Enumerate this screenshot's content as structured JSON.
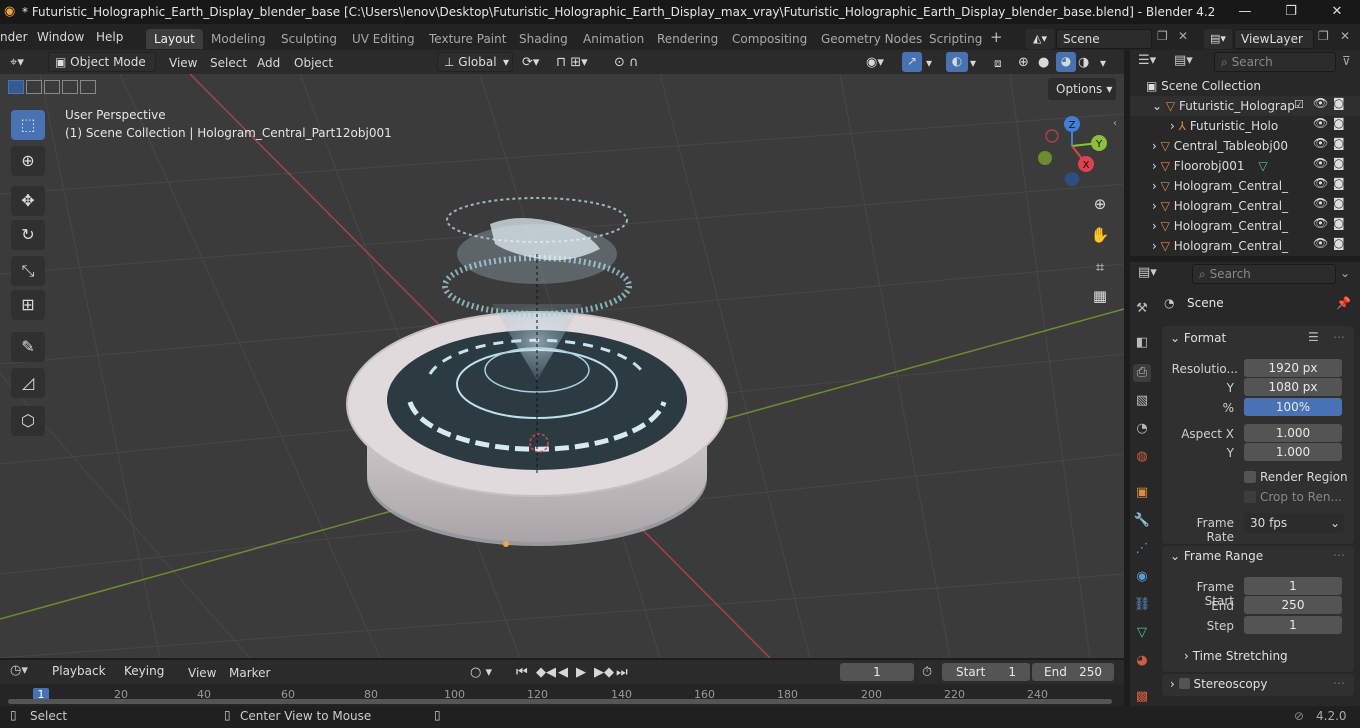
{
  "titlebar": {
    "title": "* Futuristic_Holographic_Earth_Display_blender_base [C:\\Users\\lenov\\Desktop\\Futuristic_Holographic_Earth_Display_max_vray\\Futuristic_Holographic_Earth_Display_blender_base.blend] - Blender 4.2",
    "minimize": "—",
    "maximize": "❐",
    "close": "✕"
  },
  "menu": [
    "nder",
    "Window",
    "Help"
  ],
  "workspaces": [
    "Layout",
    "Modeling",
    "Sculpting",
    "UV Editing",
    "Texture Paint",
    "Shading",
    "Animation",
    "Rendering",
    "Compositing",
    "Geometry Nodes",
    "Scripting"
  ],
  "scene": {
    "name": "Scene",
    "view_layer": "ViewLayer"
  },
  "viewport_header": {
    "mode": "Object Mode",
    "menus": [
      "View",
      "Select",
      "Add",
      "Object"
    ],
    "orientation": "Global",
    "options": "Options"
  },
  "viewport": {
    "perspective": "User Perspective",
    "collection_info": "(1) Scene Collection | Hologram_Central_Part12obj001",
    "gizmo": {
      "z": "Z",
      "y": "Y",
      "x": "X"
    }
  },
  "outliner": {
    "search_placeholder": "Search",
    "root": "Scene Collection",
    "items": [
      {
        "label": "Futuristic_Holograp"
      },
      {
        "label": "Futuristic_Holo"
      },
      {
        "label": "Central_Tableobj00"
      },
      {
        "label": "Floorobj001"
      },
      {
        "label": "Hologram_Central_"
      },
      {
        "label": "Hologram_Central_"
      },
      {
        "label": "Hologram_Central_"
      },
      {
        "label": "Hologram_Central_"
      }
    ]
  },
  "properties": {
    "search_placeholder": "Search",
    "context": "Scene",
    "format_section": "Format",
    "resolution_x_label": "Resolutio...",
    "resolution_x": "1920 px",
    "resolution_y_label": "Y",
    "resolution_y": "1080 px",
    "percent_label": "%",
    "percent": "100%",
    "aspect_x_label": "Aspect X",
    "aspect_x": "1.000",
    "aspect_y_label": "Y",
    "aspect_y": "1.000",
    "render_region": "Render Region",
    "crop": "Crop to Ren...",
    "frame_rate_label": "Frame Rate",
    "frame_rate": "30 fps",
    "frame_range_section": "Frame Range",
    "frame_start_label": "Frame Start",
    "frame_start": "1",
    "end_label": "End",
    "end": "250",
    "step_label": "Step",
    "step": "1",
    "time_stretching": "Time Stretching",
    "stereoscopy": "Stereoscopy"
  },
  "timeline": {
    "menus": [
      "Playback",
      "Keying",
      "View",
      "Marker"
    ],
    "current_frame": "1",
    "start_label": "Start",
    "start": "1",
    "end_label": "End",
    "end": "250",
    "ticks": [
      "1",
      "20",
      "40",
      "60",
      "80",
      "100",
      "120",
      "140",
      "160",
      "180",
      "200",
      "220",
      "240"
    ]
  },
  "statusbar": {
    "select": "Select",
    "center_view": "Center View to Mouse",
    "version": "4.2.0"
  },
  "colors": {
    "accent": "#4772b3",
    "x_axis": "#e0414f",
    "y_axis": "#8bc03a",
    "z_axis": "#3f7fd7"
  }
}
